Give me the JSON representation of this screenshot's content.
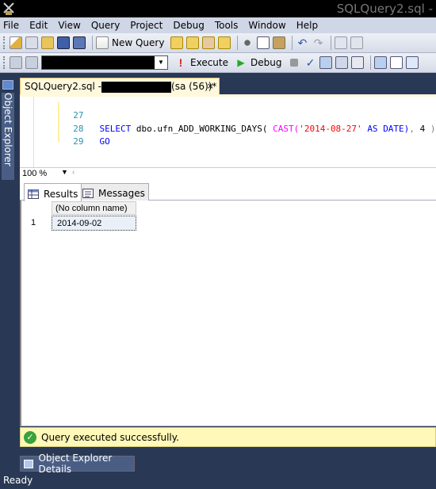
{
  "window": {
    "title": "SQLQuery2.sql -",
    "app_icon": "ssms-app-icon"
  },
  "menu": {
    "items": [
      "File",
      "Edit",
      "View",
      "Query",
      "Project",
      "Debug",
      "Tools",
      "Window",
      "Help"
    ]
  },
  "toolbar1": {
    "new_query_label": "New Query",
    "icons": [
      "new-project-icon",
      "add-item-icon",
      "open-file-icon",
      "save-icon",
      "save-all-icon",
      "new-query-icon",
      "query-mdx-icon",
      "query-dmx-icon",
      "query-xmla-icon",
      "query-sqlce-icon",
      "cut-icon",
      "copy-icon",
      "paste-icon",
      "undo-icon",
      "redo-icon",
      "navigate-back-icon",
      "navigate-forward-icon"
    ]
  },
  "toolbar2": {
    "database_value": "",
    "execute_label": "Execute",
    "debug_label": "Debug",
    "icons": [
      "execute-icon",
      "debug-icon",
      "stop-icon",
      "parse-icon",
      "display-plan-icon",
      "query-options-icon",
      "intellisense-icon",
      "include-plan-icon",
      "results-to-text-icon",
      "results-to-grid-icon"
    ]
  },
  "sidebar": {
    "object_explorer_label": "Object Explorer"
  },
  "doc_tab": {
    "label_prefix": "SQLQuery2.sql -",
    "label_suffix": "(sa (56))*",
    "close_glyph": "×"
  },
  "editor": {
    "lines": [
      {
        "number": "27"
      },
      {
        "number": "28"
      },
      {
        "number": "29"
      }
    ],
    "line28": {
      "select": "SELECT",
      "fn": "dbo.ufn_ADD_WORKING_DAYS(",
      "cast": "CAST(",
      "str": "'2014-08-27'",
      "as": "AS",
      "date": "DATE)",
      "comma": ",",
      "num": "4",
      "close": ")"
    },
    "line29": {
      "go": "GO"
    }
  },
  "zoom": {
    "value": "100 %"
  },
  "results": {
    "tabs": [
      {
        "label": "Results",
        "icon": "grid-icon",
        "active": true
      },
      {
        "label": "Messages",
        "icon": "messages-icon",
        "active": false
      }
    ],
    "columns": [
      "(No column name)"
    ],
    "rows": [
      {
        "num": "1",
        "values": [
          "2014-09-02"
        ]
      }
    ]
  },
  "message": {
    "text": "Query executed successfully.",
    "icon": "success-check-icon",
    "color": "#3aa23a"
  },
  "bottom_tab": {
    "label": "Object Explorer Details"
  },
  "status": {
    "text": "Ready"
  }
}
